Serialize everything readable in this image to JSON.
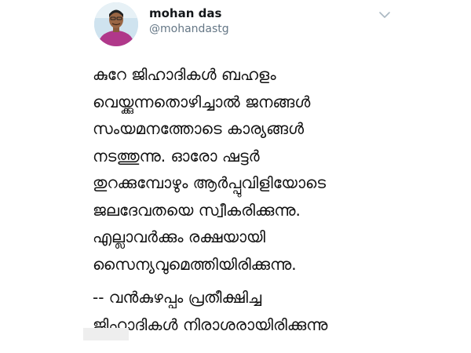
{
  "user": {
    "display_name": "mohan das",
    "handle": "@mohandastg",
    "avatar_icon": "avatar-photo"
  },
  "menu": {
    "icon": "chevron-down-icon"
  },
  "tweet": {
    "lines": [
      "കുറേ ജിഹാദികൾ ബഹളം",
      "വെയ്ക്കുന്നതൊഴിച്ചാൽ  ജനങ്ങൾ",
      "സംയമനത്തോടെ കാര്യങ്ങൾ",
      "നടത്തുന്നു. ഓരോ ഷട്ടർ",
      "തുറക്കുമ്പോഴും ആർപ്പുവിളിയോടെ",
      "ജലദേവതയെ സ്വീകരിക്കുന്നു.",
      "എല്ലാവർക്കും രക്ഷയായി",
      "സൈന്യവുമെത്തിയിരിക്കുന്നു.",
      "-- വൻകുഴപ്പം പ്രതീക്ഷിച്ച",
      "ജിഹാദികൾ നിരാശരായിരിക്കുന്നു"
    ]
  },
  "colors": {
    "name_text": "#14171a",
    "handle_text": "#657786",
    "body_text": "#111111",
    "background": "#ffffff"
  }
}
